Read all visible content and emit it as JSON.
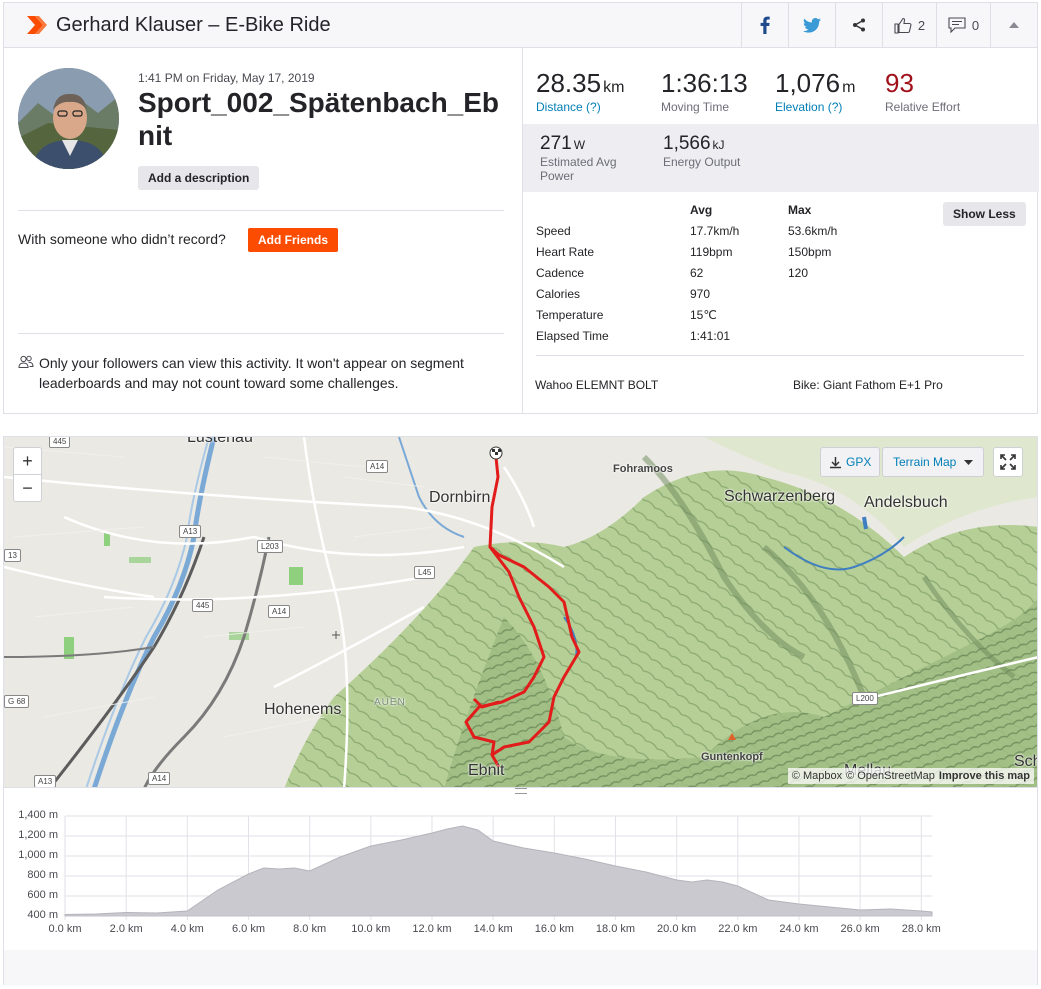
{
  "header": {
    "title": "Gerhard Klauser – E-Bike Ride",
    "kudos_count": "2",
    "comment_count": "0"
  },
  "activity": {
    "datetime": "1:41 PM on Friday, May 17, 2019",
    "name": "Sport_002_Spätenbach_Ebnit",
    "add_description": "Add a description",
    "with_someone": "With someone who didn’t record?",
    "add_friends": "Add Friends",
    "privacy_text": "Only your followers can view this activity. It won't appear on segment leaderboards and may not count toward some challenges."
  },
  "stats": {
    "distance": {
      "value": "28.35",
      "unit": "km",
      "label": "Distance (?)"
    },
    "moving_time": {
      "value": "1:36:13",
      "label": "Moving Time"
    },
    "elevation": {
      "value": "1,076",
      "unit": "m",
      "label": "Elevation (?)"
    },
    "relative_effort": {
      "value": "93",
      "label": "Relative Effort"
    },
    "power": {
      "value": "271",
      "unit": "W",
      "label": "Estimated Avg Power"
    },
    "energy": {
      "value": "1,566",
      "unit": "kJ",
      "label": "Energy Output"
    }
  },
  "more_stats": {
    "show_less": "Show Less",
    "col_avg": "Avg",
    "col_max": "Max",
    "rows": [
      {
        "label": "Speed",
        "avg": "17.7km/h",
        "max": "53.6km/h"
      },
      {
        "label": "Heart Rate",
        "avg": "119bpm",
        "max": "150bpm"
      },
      {
        "label": "Cadence",
        "avg": "62",
        "max": "120"
      },
      {
        "label": "Calories",
        "avg": "970",
        "max": ""
      },
      {
        "label": "Temperature",
        "avg": "15℃",
        "max": ""
      },
      {
        "label": "Elapsed Time",
        "avg": "1:41:01",
        "max": ""
      }
    ],
    "device": "Wahoo ELEMNT BOLT",
    "bike": "Bike: Giant Fathom E+1 Pro"
  },
  "map": {
    "gpx_label": "GPX",
    "map_type": "Terrain Map",
    "attribution_mapbox": "© Mapbox",
    "attribution_osm": "© OpenStreetMap",
    "improve": "Improve this map",
    "towns": {
      "lustenau": "Lustenau",
      "dornbirn": "Dornbirn",
      "schwarzenberg": "Schwarzenberg",
      "andelsbuch": "Andelsbuch",
      "hohenems": "Hohenems",
      "ebnit": "Ebnit",
      "mellau": "Mellau",
      "sch": "Sch",
      "auen": "AUEN",
      "fohramoos": "Fohramoos",
      "guntenkopf": "Guntenkopf"
    },
    "roads": [
      "445",
      "A14",
      "A13",
      "13",
      "L203",
      "445",
      "A14",
      "L45",
      "G 68",
      "A13",
      "A14",
      "L200"
    ]
  },
  "elevation_chart": {
    "type": "area",
    "y_ticks": [
      "1,400 m",
      "1,200 m",
      "1,000 m",
      "800 m",
      "600 m",
      "400 m"
    ],
    "x_ticks": [
      "0.0 km",
      "2.0 km",
      "4.0 km",
      "6.0 km",
      "8.0 km",
      "10.0 km",
      "12.0 km",
      "14.0 km",
      "16.0 km",
      "18.0 km",
      "20.0 km",
      "22.0 km",
      "24.0 km",
      "26.0 km",
      "28.0 km"
    ],
    "ylim": [
      400,
      1400
    ],
    "xlim": [
      0,
      28.35
    ],
    "x": [
      0,
      1,
      2,
      3,
      4,
      5,
      6,
      6.5,
      7,
      7.5,
      8,
      9,
      10,
      11,
      12,
      12.5,
      13,
      13.5,
      14,
      15,
      16,
      17,
      18,
      19,
      20,
      20.5,
      21,
      21.5,
      22,
      23,
      24,
      25,
      26,
      27,
      28,
      28.35
    ],
    "y": [
      415,
      420,
      435,
      430,
      450,
      660,
      820,
      880,
      870,
      880,
      850,
      990,
      1100,
      1160,
      1230,
      1270,
      1300,
      1260,
      1150,
      1080,
      1030,
      970,
      900,
      840,
      760,
      740,
      760,
      740,
      700,
      560,
      520,
      490,
      460,
      470,
      450,
      440
    ]
  }
}
